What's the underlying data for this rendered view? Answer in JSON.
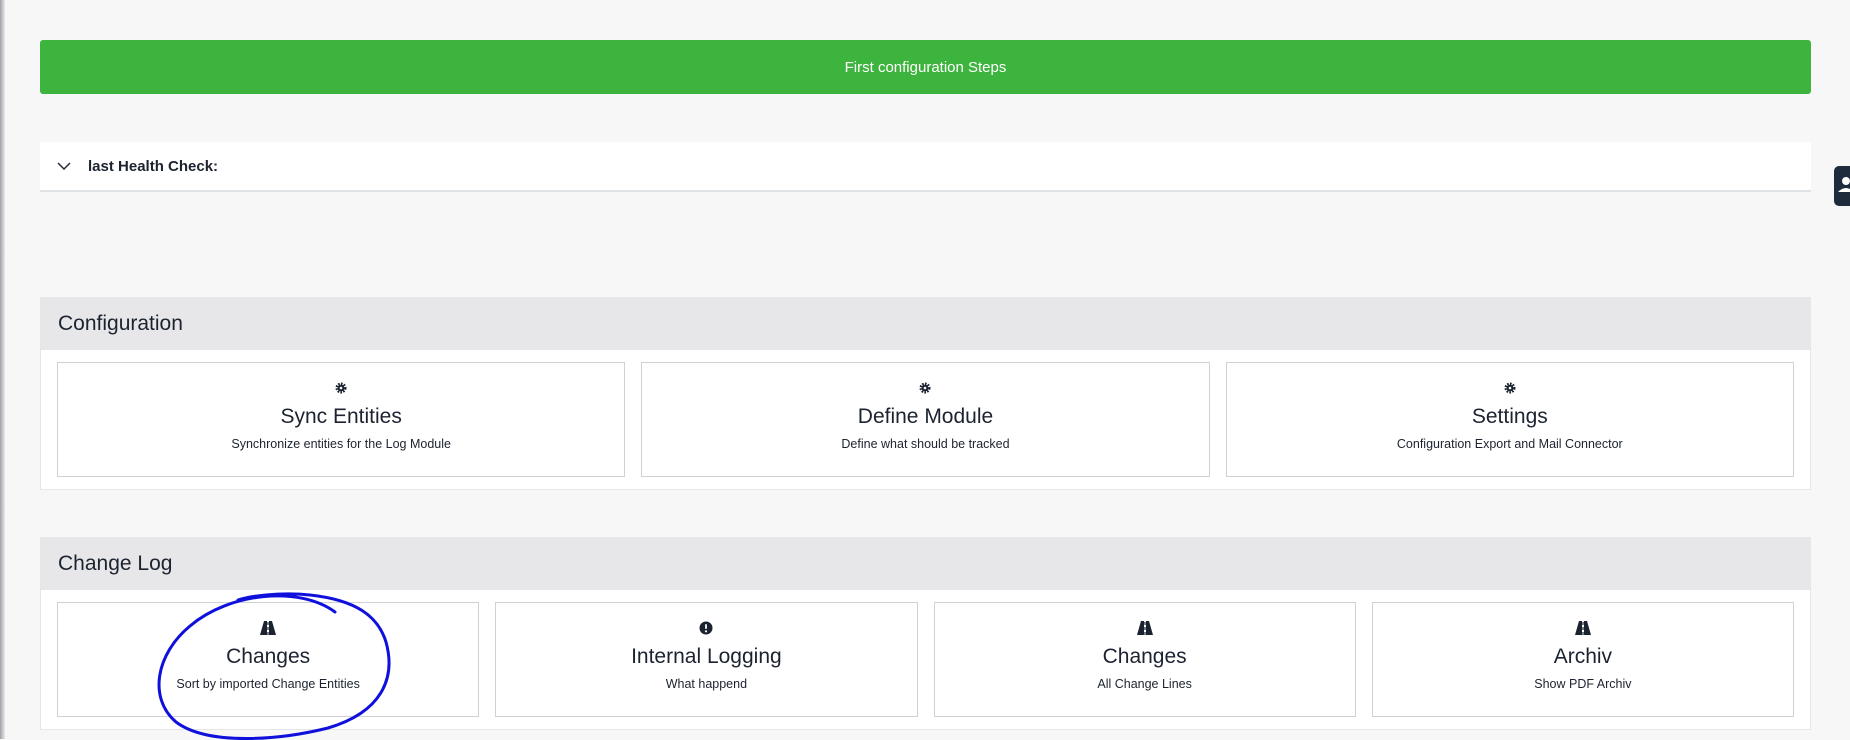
{
  "banner": {
    "label": "First configuration Steps",
    "color": "#3db43d"
  },
  "health": {
    "title": "last Health Check:"
  },
  "sections": [
    {
      "title": "Configuration",
      "cards": [
        {
          "icon": "gear-icon",
          "title": "Sync Entities",
          "subtitle": "Synchronize entities for the Log Module"
        },
        {
          "icon": "gear-icon",
          "title": "Define Module",
          "subtitle": "Define what should be tracked"
        },
        {
          "icon": "gear-icon",
          "title": "Settings",
          "subtitle": "Configuration Export and Mail Connector"
        }
      ]
    },
    {
      "title": "Change Log",
      "cards": [
        {
          "icon": "road-icon",
          "title": "Changes",
          "subtitle": "Sort by imported Change Entities"
        },
        {
          "icon": "exclamation-circle-icon",
          "title": "Internal Logging",
          "subtitle": "What happend"
        },
        {
          "icon": "road-icon",
          "title": "Changes",
          "subtitle": "All Change Lines"
        },
        {
          "icon": "road-icon",
          "title": "Archiv",
          "subtitle": "Show PDF Archiv"
        }
      ]
    }
  ],
  "annotation": {
    "shape": "hand-drawn ellipse",
    "color": "#1010dd"
  }
}
